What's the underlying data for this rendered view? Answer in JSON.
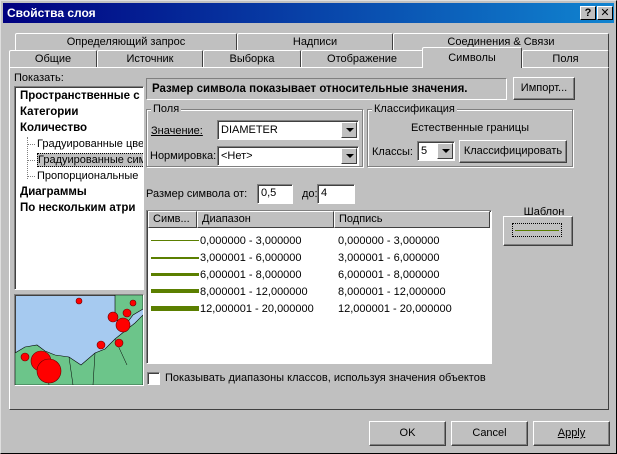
{
  "window": {
    "title": "Свойства слоя",
    "help_label": "?",
    "close_label": "✕"
  },
  "tabs_back": [
    {
      "label": "Определяющий запрос"
    },
    {
      "label": "Надписи"
    },
    {
      "label": "Соединения & Связи"
    }
  ],
  "tabs_front": [
    {
      "label": "Общие"
    },
    {
      "label": "Источник"
    },
    {
      "label": "Выборка"
    },
    {
      "label": "Отображение"
    },
    {
      "label": "Символы"
    },
    {
      "label": "Поля"
    }
  ],
  "show": {
    "label": "Показать:",
    "items": [
      {
        "label": "Пространственные с",
        "bold": true
      },
      {
        "label": "Категории",
        "bold": true
      },
      {
        "label": "Количество",
        "bold": true
      },
      {
        "label": "Градуированные цве",
        "bold": false
      },
      {
        "label": "Градуированные сим",
        "bold": false,
        "selected": true
      },
      {
        "label": "Пропорциональные",
        "bold": false
      },
      {
        "label": "Диаграммы",
        "bold": true
      },
      {
        "label": "По нескольким атри",
        "bold": true
      }
    ]
  },
  "description": "Размер символа показывает относительные значения.",
  "import_label": "Импорт...",
  "fields": {
    "group_label": "Поля",
    "value_label": "Значение:",
    "value": "DIAMETER",
    "normalize_label": "Нормировка:",
    "normalize_value": "<Нет>"
  },
  "classification": {
    "group_label": "Классификация",
    "method": "Естественные границы",
    "classes_label": "Классы:",
    "classes_value": "5",
    "classify_label": "Классифицировать"
  },
  "symbol_size": {
    "from_label": "Размер символа от:",
    "from_value": "0,5",
    "to_label": "до:",
    "to_value": "4"
  },
  "template_label": "Шаблон",
  "table": {
    "headers": [
      "Симв...",
      "Диапазон",
      "Подпись"
    ],
    "rows": [
      {
        "range": "0,000000 - 3,000000",
        "label": "0,000000 - 3,000000"
      },
      {
        "range": "3,000001 - 6,000000",
        "label": "3,000001 - 6,000000"
      },
      {
        "range": "6,000001 - 8,000000",
        "label": "6,000001 - 8,000000"
      },
      {
        "range": "8,000001 - 12,000000",
        "label": "8,000001 - 12,000000"
      },
      {
        "range": "12,000001 - 20,000000",
        "label": "12,000001 - 20,000000"
      }
    ],
    "symbol_color": "#5b7f00"
  },
  "show_ranges_checkbox": {
    "label": "Показывать диапазоны классов, используя значения объектов",
    "checked": false
  },
  "buttons": {
    "ok": "OK",
    "cancel": "Cancel",
    "apply": "Apply"
  },
  "colors": {
    "title_start": "#000080",
    "title_end": "#1084d0",
    "face": "#c0c0c0",
    "map_water": "#a6caf0",
    "map_land": "#6cc58a",
    "map_symbol": "#ff0000"
  }
}
